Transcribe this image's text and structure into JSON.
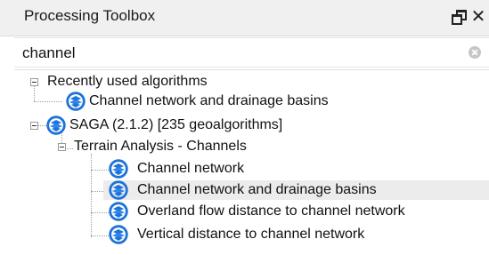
{
  "panel": {
    "title": "Processing Toolbox",
    "float_icon": "float-window-icon",
    "close_icon": "close-icon",
    "close_glyph": "✕"
  },
  "search": {
    "value": "channel",
    "placeholder": "",
    "clear_icon": "clear-search-icon"
  },
  "tree": {
    "groups": [
      {
        "label": "Recently used algorithms",
        "expanded": true,
        "items": [
          {
            "label": "Channel network and drainage basins",
            "icon": "saga-icon"
          }
        ]
      },
      {
        "label": "SAGA (2.1.2) [235 geoalgorithms]",
        "icon": "saga-icon",
        "expanded": true,
        "subgroups": [
          {
            "label": "Terrain Analysis - Channels",
            "expanded": true,
            "items": [
              {
                "label": "Channel network",
                "icon": "saga-icon",
                "selected": false
              },
              {
                "label": "Channel network and drainage basins",
                "icon": "saga-icon",
                "selected": true
              },
              {
                "label": "Overland flow distance to channel network",
                "icon": "saga-icon",
                "selected": false
              },
              {
                "label": "Vertical distance to channel network",
                "icon": "saga-icon",
                "selected": false
              }
            ]
          }
        ]
      }
    ]
  },
  "colors": {
    "titlebar_bg": "#f0f0f0",
    "selection_bg": "#ececec",
    "saga_blue": "#1e73d8"
  }
}
